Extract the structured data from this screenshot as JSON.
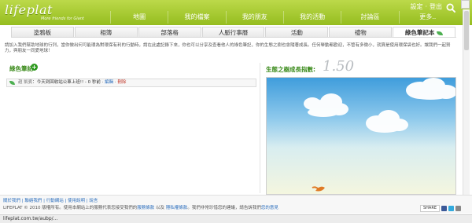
{
  "header": {
    "logo": "lifeplat",
    "logo_sub": "More friends for Giant",
    "top_links": [
      "設定",
      "登出"
    ],
    "nav": [
      "地圖",
      "我的檔案",
      "我的朋友",
      "我的活動",
      "討論區",
      "更多.."
    ]
  },
  "subtabs": [
    "塗鴉板",
    "相簿",
    "部落格",
    "人脈行事曆",
    "活動",
    "禮物",
    "綠色筆記本"
  ],
  "active_tab": "綠色筆記本",
  "intro": "請加入我們幫助地球的行列，當你做出何可能環為對環保有利的行動時，請在此處記錄下來，你也可以分享及查看他人的綠色筆記，你的生態之樹也會隨著成長。任何舉動都歡迎，不管有多微小，就算是使用環保袋也好。讓我們一起努力，與朋友一同愛地球！",
  "left": {
    "title": "綠色筆記",
    "add_label": "+",
    "note": {
      "user": "趙 凱賓",
      "text": "：今天到回收站公車上班!!",
      "time": " - 0 秒前 · ",
      "edit": "編輯",
      "sep": " · ",
      "delete": "刪除"
    }
  },
  "right": {
    "growth_label": "生態之樹成長指數:",
    "growth_value": "1.50"
  },
  "footer": {
    "links": "關於我們 | 聯絡我們 | 行動網站 | 使用說明 | 說言",
    "copy_prefix": "LIFEPLAT © 2010 版權所有。使用本網站上的服務代表您接受我們的",
    "copy_terms": "服務條款",
    "copy_and": " 以及 ",
    "copy_privacy": "隱私權條款",
    "copy_suffix": "。我們非常珍惜您的建議，請告訴我們",
    "copy_feedback": "您的意見",
    "share_label": "SHARE"
  },
  "status_bar": "lifeplat.com.tw/aubp/...",
  "colors": {
    "brand": "#95bd1f",
    "accent_green": "#3a8a1a",
    "link": "#2d6fbd"
  }
}
